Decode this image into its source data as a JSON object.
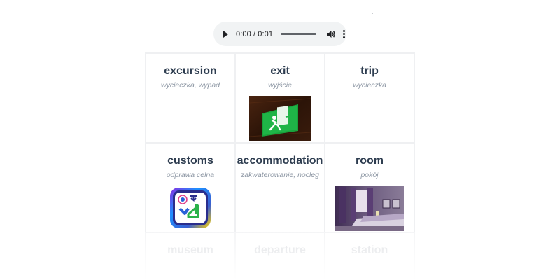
{
  "audio": {
    "time": "0:00 / 0:01",
    "progress": 0.0
  },
  "cards": [
    {
      "word": "excursion",
      "translation": "wycieczka, wypad",
      "image": null
    },
    {
      "word": "exit",
      "translation": "wyjście",
      "image": "exit-sign"
    },
    {
      "word": "trip",
      "translation": "wycieczka",
      "image": null
    },
    {
      "word": "customs",
      "translation": "odprawa celna",
      "image": "customs-app-icon"
    },
    {
      "word": "accommodation",
      "translation": "zakwaterowanie, nocleg",
      "image": null
    },
    {
      "word": "room",
      "translation": "pokój",
      "image": "room-photo"
    },
    {
      "word": "museum",
      "translation": "",
      "image": null
    },
    {
      "word": "departure",
      "translation": "",
      "image": null
    },
    {
      "word": "station",
      "translation": "",
      "image": null
    }
  ],
  "colors": {
    "word": "#2e3d50",
    "translation": "#8c96a3",
    "border": "#eff0f2",
    "player_bg": "#f1f3f4"
  }
}
